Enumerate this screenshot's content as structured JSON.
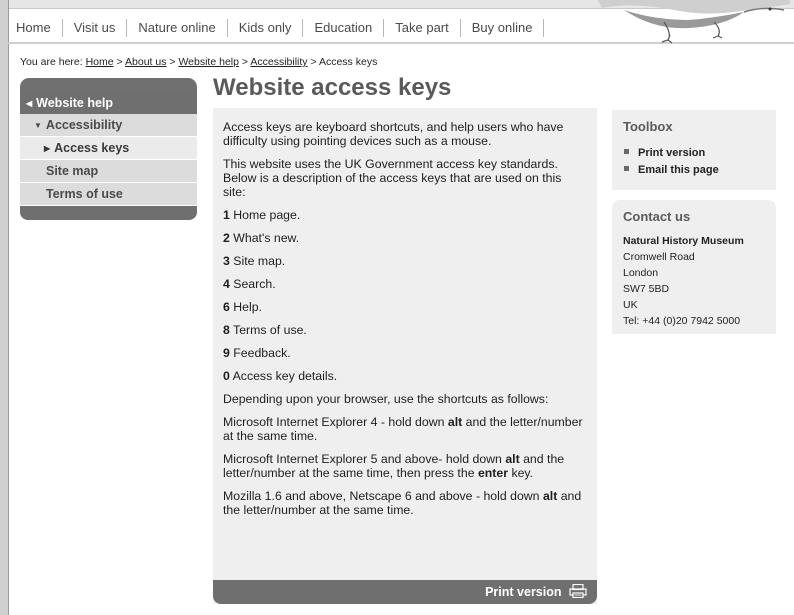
{
  "nav": {
    "items": [
      "Home",
      "Visit us",
      "Nature online",
      "Kids only",
      "Education",
      "Take part",
      "Buy online"
    ]
  },
  "breadcrumb": {
    "prefix": "You are here:",
    "links": [
      "Home",
      "About us",
      "Website help",
      "Accessibility"
    ],
    "separator": ">",
    "current": "Access keys"
  },
  "sidebar": {
    "header": "Website help",
    "items": [
      {
        "label": "Accessibility"
      },
      {
        "label": "Access keys"
      },
      {
        "label": "Site map"
      },
      {
        "label": "Terms of use"
      }
    ]
  },
  "main": {
    "title": "Website access keys",
    "intro1": "Access keys are keyboard shortcuts, and help users who have difficulty using pointing devices such as a mouse.",
    "intro2": "This website uses the UK Government access key standards. Below is a description of the access keys that are used on this site:",
    "keys": [
      {
        "key": "1",
        "desc": "Home page."
      },
      {
        "key": "2",
        "desc": "What's new."
      },
      {
        "key": "3",
        "desc": "Site map."
      },
      {
        "key": "4",
        "desc": "Search."
      },
      {
        "key": "6",
        "desc": "Help."
      },
      {
        "key": "8",
        "desc": "Terms of use."
      },
      {
        "key": "9",
        "desc": "Feedback."
      },
      {
        "key": "0",
        "desc": "Access key details."
      }
    ],
    "browser_intro": "Depending upon your browser, use the shortcuts as follows:",
    "ie4": {
      "pre": "Microsoft Internet Explorer 4 - hold down ",
      "bold": "alt",
      "post": " and the letter/number at the same time."
    },
    "ie5": {
      "pre": "Microsoft Internet Explorer 5 and above- hold down ",
      "bold1": "alt",
      "mid": " and the letter/number at the same time, then press the ",
      "bold2": "enter",
      "post": " key."
    },
    "mozilla": {
      "pre": "Mozilla 1.6 and above, Netscape 6 and above - hold down ",
      "bold": "alt",
      "post": " and the letter/number at the same time."
    },
    "print_label": "Print version"
  },
  "toolbox": {
    "title": "Toolbox",
    "items": [
      "Print version",
      "Email this page"
    ]
  },
  "contact": {
    "title": "Contact us",
    "org": "Natural History Museum",
    "lines": [
      "Cromwell Road",
      "London",
      "SW7 5BD",
      "UK",
      "Tel: +44 (0)20 7942 5000"
    ]
  }
}
